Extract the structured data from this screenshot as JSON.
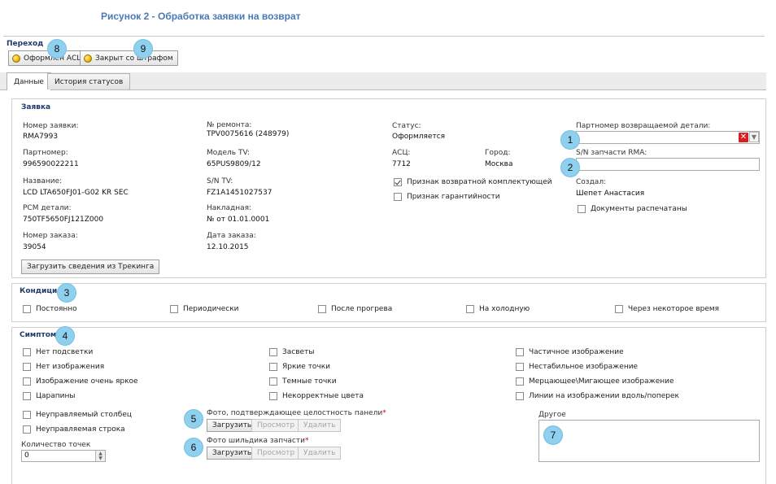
{
  "caption": "Рисунок 2 - Обработка заявки на возврат",
  "transition": {
    "label": "Переход",
    "buttons": [
      {
        "label": "Оформлен АСЦ",
        "icon": "coin-icon"
      },
      {
        "label": "Закрыт со штрафом",
        "icon": "coin-icon"
      }
    ]
  },
  "tabs": [
    {
      "label": "Данные",
      "active": true
    },
    {
      "label": "История статусов",
      "active": false
    }
  ],
  "request": {
    "title": "Заявка",
    "fields": {
      "request_no": {
        "label": "Номер заявки:",
        "value": "RMA7993"
      },
      "repair_no": {
        "label": "№ ремонта:",
        "value": "TPV0075616 (248979)"
      },
      "status": {
        "label": "Статус:",
        "value": "Оформляется"
      },
      "return_part_no": {
        "label": "Партномер возвращаемой детали:",
        "value": ""
      },
      "partnumber": {
        "label": "Партномер:",
        "value": "996590022211"
      },
      "tv_model": {
        "label": "Модель TV:",
        "value": "65PUS9809/12"
      },
      "asc": {
        "label": "АСЦ:",
        "value": "7712"
      },
      "city": {
        "label": "Город:",
        "value": "Москва"
      },
      "rma_sn": {
        "label": "S/N запчасти RMA:",
        "value": ""
      },
      "name": {
        "label": "Название:",
        "value": "LCD LTA650FJ01-G02 KR SEC"
      },
      "tv_sn": {
        "label": "S/N TV:",
        "value": "FZ1A1451027537"
      },
      "created_by": {
        "label": "Создал:",
        "value": "Шепет Анастасия"
      },
      "pcm": {
        "label": "PCM детали:",
        "value": "750TF5650FJ121Z000"
      },
      "invoice": {
        "label": "Накладная:",
        "value": "№  от 01.01.0001"
      },
      "order_no": {
        "label": "Номер заказа:",
        "value": "39054"
      },
      "order_date": {
        "label": "Дата заказа:",
        "value": "12.10.2015"
      }
    },
    "checks": {
      "return_component": {
        "label": "Признак возвратной комплектующей",
        "checked": true
      },
      "warranty": {
        "label": "Признак гарантийности",
        "checked": false
      },
      "docs_printed": {
        "label": "Документы распечатаны",
        "checked": false
      }
    },
    "load_button": "Загрузить сведения из Трекинга"
  },
  "condition": {
    "title": "Кондиция",
    "options": [
      "Постоянно",
      "Периодически",
      "После прогрева",
      "На холодную",
      "Через некоторое время"
    ]
  },
  "symptoms": {
    "title": "Симптомы",
    "col1": [
      "Нет подсветки",
      "Нет изображения",
      "Изображение очень яркое",
      "Царапины"
    ],
    "col2": [
      "Засветы",
      "Яркие точки",
      "Темные точки",
      "Некорректные цвета"
    ],
    "col3": [
      "Частичное изображение",
      "Нестабильное изображение",
      "Мерцающее\\Мигающее изображение",
      "Линии на изображении вдоль/поперек"
    ],
    "extra": [
      "Неуправляемый столбец",
      "Неуправляемая строка"
    ],
    "points_label": "Количество точек",
    "points_value": "0",
    "photo_panel_label": "Фото, подтверждающее целостность панели",
    "photo_plate_label": "Фото шильдика запчасти",
    "required_mark": "*",
    "upload": "Загрузить",
    "view": "Просмотр",
    "delete": "Удалить",
    "other_label": "Другое"
  },
  "markers": [
    "1",
    "2",
    "3",
    "4",
    "5",
    "6",
    "7",
    "8",
    "9"
  ],
  "colors": {
    "caption": "#4a78b8",
    "section": "#1f3b6e",
    "marker": "#8fd0ef"
  }
}
